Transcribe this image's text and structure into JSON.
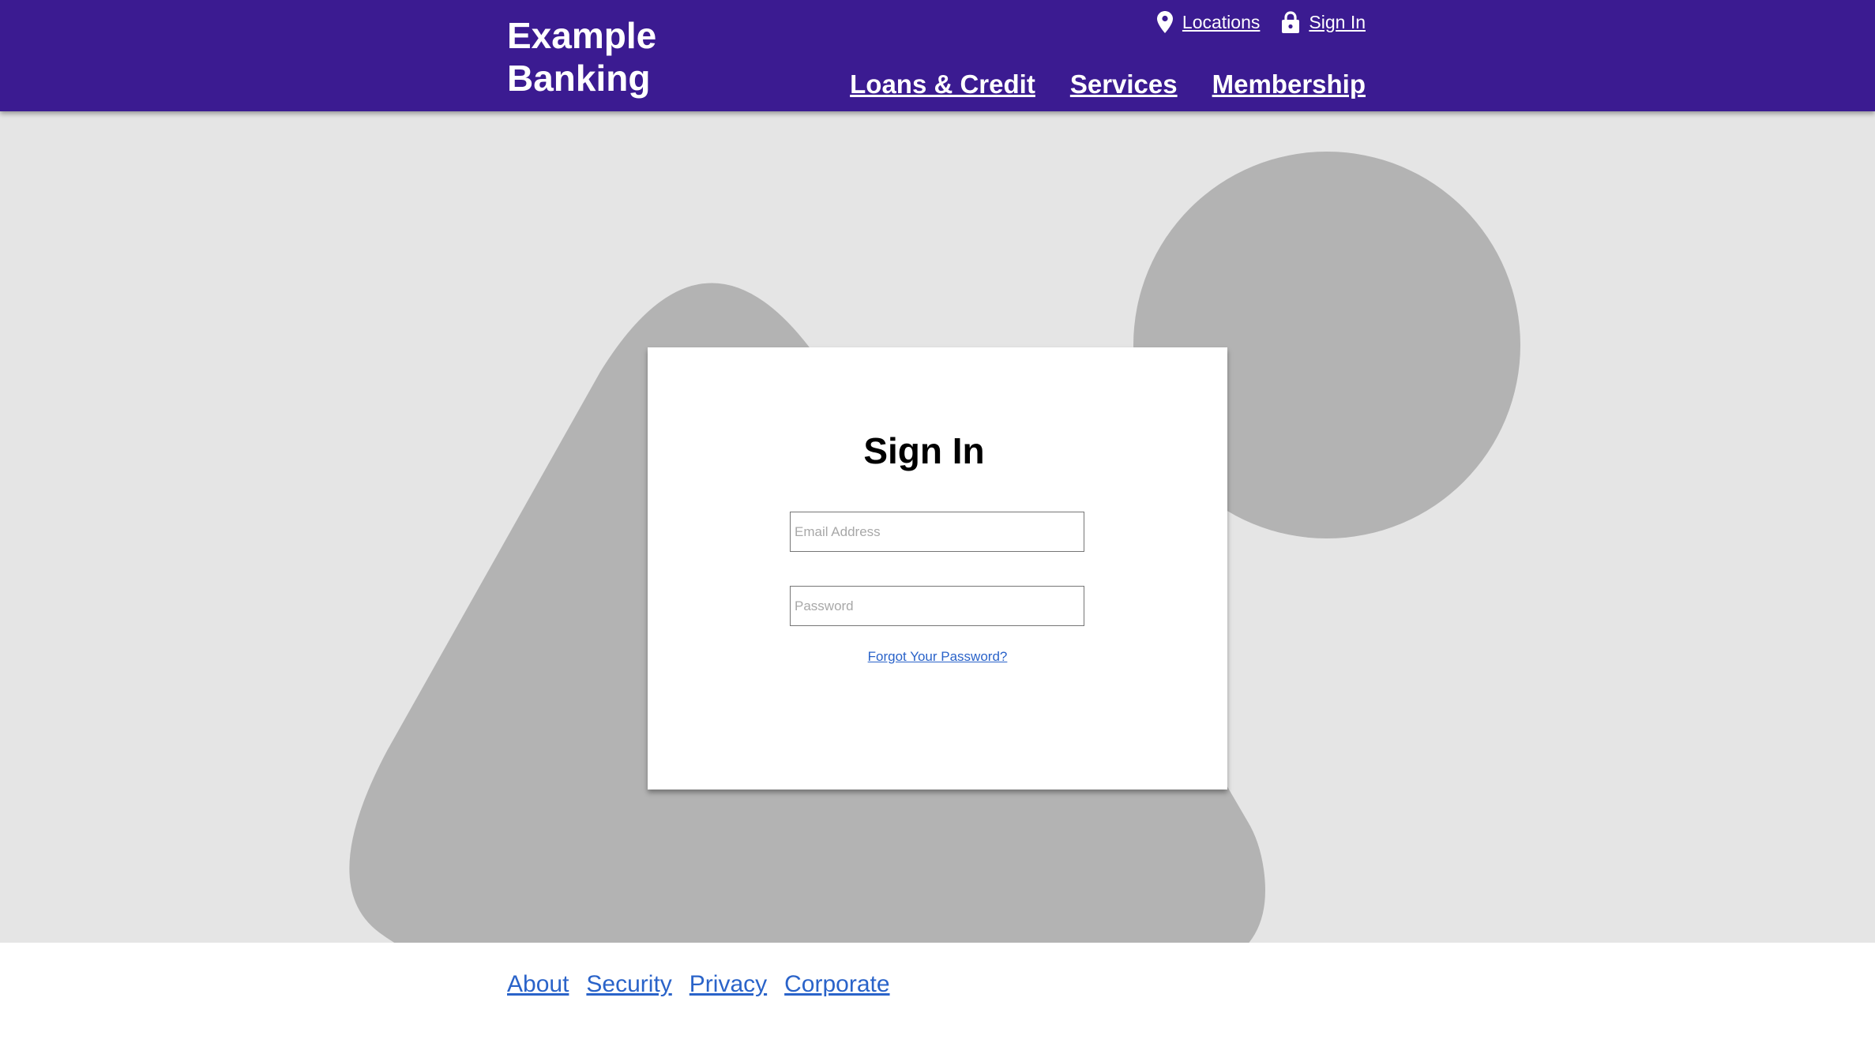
{
  "header": {
    "brand": "Example Banking",
    "utility_nav": [
      {
        "label": "Locations",
        "icon": "map-pin-icon"
      },
      {
        "label": "Sign In",
        "icon": "lock-icon"
      }
    ],
    "main_nav": [
      {
        "label": "Loans & Credit"
      },
      {
        "label": "Services"
      },
      {
        "label": "Membership"
      }
    ],
    "background_color": "#3b1b91"
  },
  "signin": {
    "title": "Sign In",
    "email_placeholder": "Email Address",
    "email_value": "",
    "password_placeholder": "Password",
    "password_value": "",
    "forgot_link": "Forgot Your Password?"
  },
  "footer": {
    "links": [
      {
        "label": "About"
      },
      {
        "label": "Security"
      },
      {
        "label": "Privacy"
      },
      {
        "label": "Corporate"
      }
    ]
  },
  "colors": {
    "accent": "#3b1b91",
    "link": "#2a63c9",
    "hero_background": "#e5e5e5",
    "decor_shapes": "#b3b3b3"
  }
}
